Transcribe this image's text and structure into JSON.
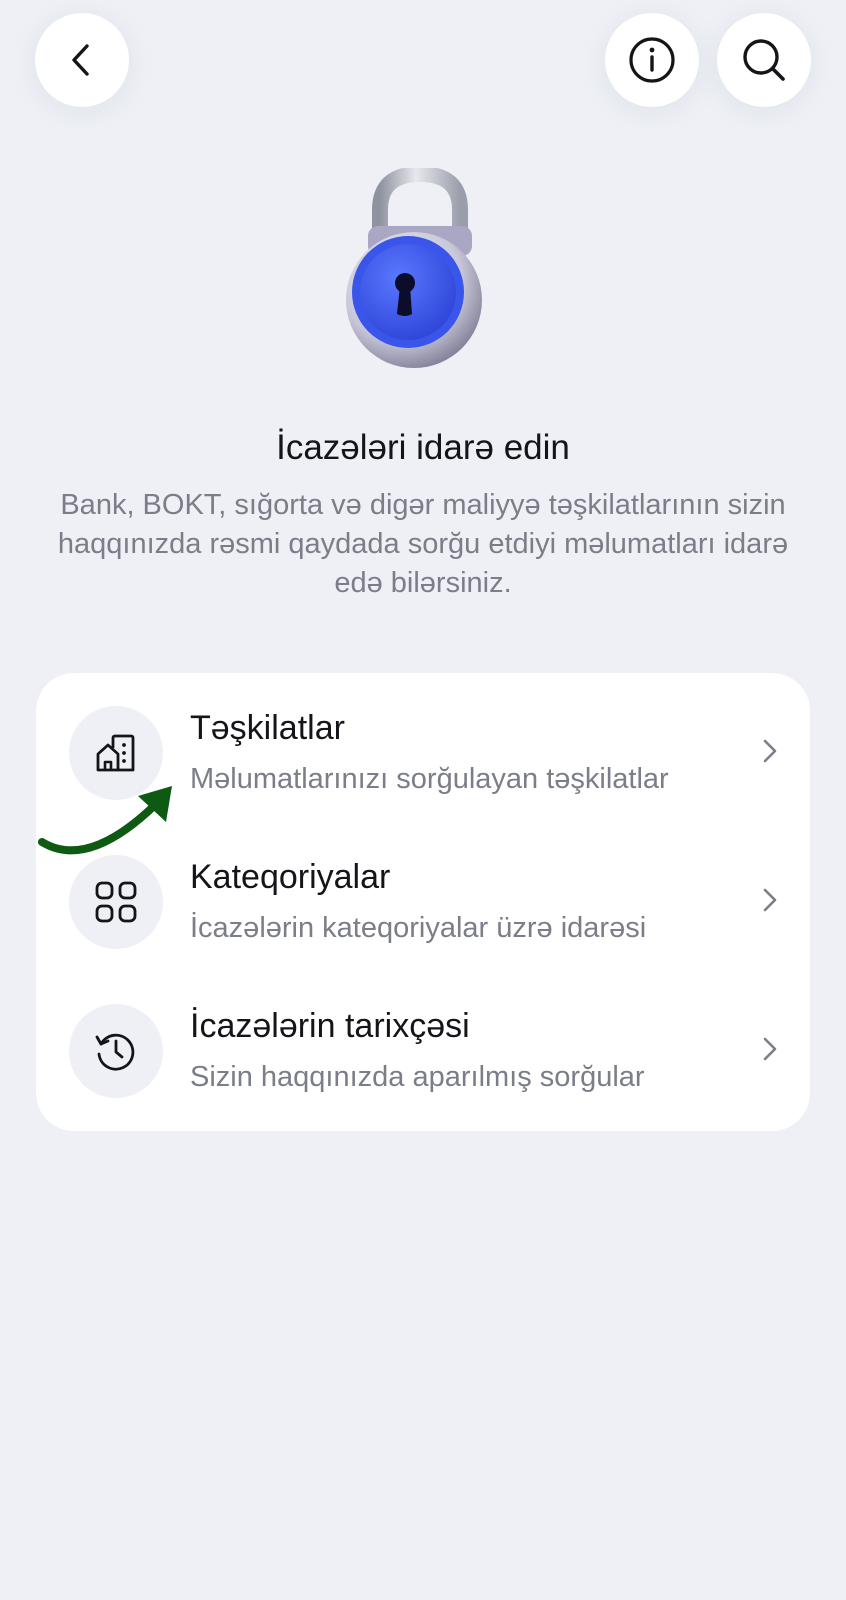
{
  "header": {
    "back_icon": "chevron-left-icon",
    "info_icon": "info-circle-icon",
    "search_icon": "search-icon"
  },
  "hero": {
    "illustration": "padlock-icon",
    "title": "İcazələri idarə edin",
    "subtitle": "Bank, BOKT, sığorta və digər maliyyə təşkilatlarının sizin haqqınızda rəsmi qaydada sorğu etdiyi məlumatları idarə edə bilərsiniz."
  },
  "menu": {
    "items": [
      {
        "icon": "buildings-icon",
        "title": "Təşkilatlar",
        "subtitle": "Məlumatlarınızı sorğulayan təşkilatlar"
      },
      {
        "icon": "grid-icon",
        "title": "Kateqoriyalar",
        "subtitle": "İcazələrin kateqoriyalar üzrə idarəsi"
      },
      {
        "icon": "history-icon",
        "title": "İcazələrin tarixçəsi",
        "subtitle": "Sizin haqqınızda aparılmış sorğular"
      }
    ]
  },
  "colors": {
    "background": "#eef0f6",
    "card": "#ffffff",
    "lock_blue": "#3f5ff0",
    "annotation_arrow": "#0e5a12"
  }
}
